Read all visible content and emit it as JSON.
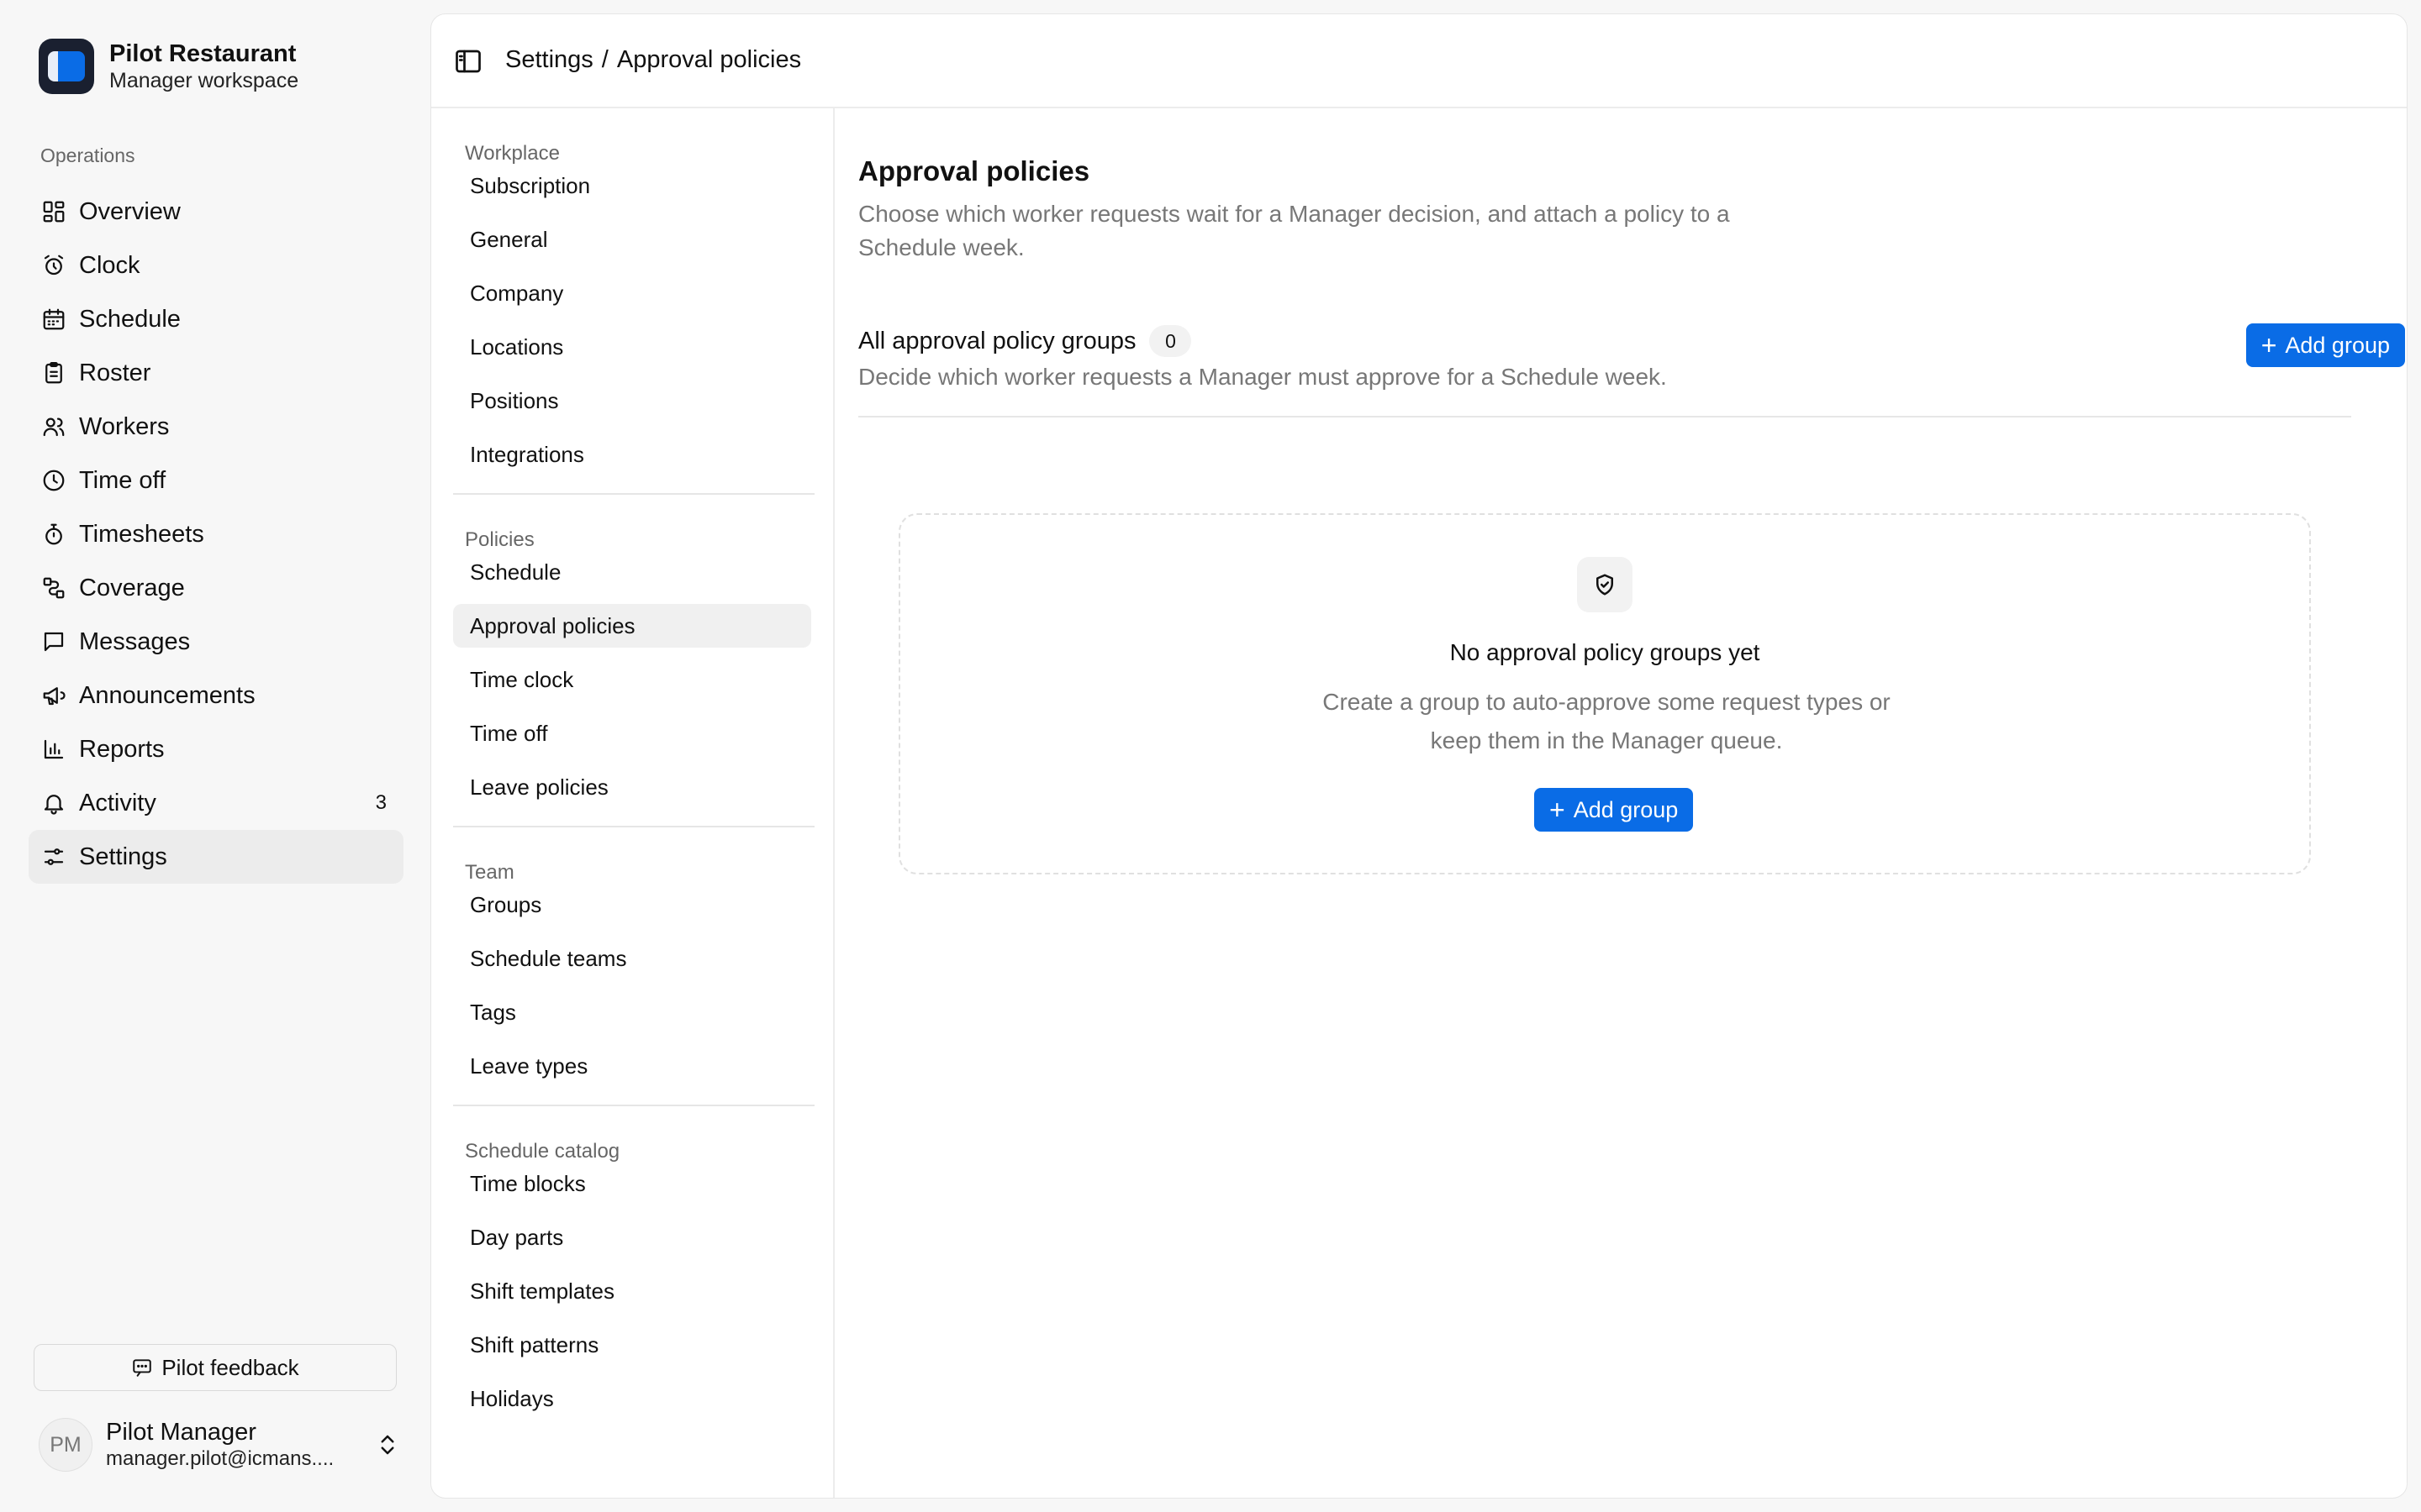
{
  "brand": {
    "name": "Pilot Restaurant",
    "subtitle": "Manager workspace"
  },
  "sidebar": {
    "section_label": "Operations",
    "items": [
      {
        "label": "Overview",
        "icon": "grid-icon"
      },
      {
        "label": "Clock",
        "icon": "alarm-clock-icon"
      },
      {
        "label": "Schedule",
        "icon": "calendar-icon"
      },
      {
        "label": "Roster",
        "icon": "clipboard-icon"
      },
      {
        "label": "Workers",
        "icon": "users-icon"
      },
      {
        "label": "Time off",
        "icon": "clock-icon"
      },
      {
        "label": "Timesheets",
        "icon": "stopwatch-icon"
      },
      {
        "label": "Coverage",
        "icon": "route-icon"
      },
      {
        "label": "Messages",
        "icon": "message-icon"
      },
      {
        "label": "Announcements",
        "icon": "megaphone-icon"
      },
      {
        "label": "Reports",
        "icon": "bar-chart-icon"
      },
      {
        "label": "Activity",
        "icon": "bell-icon",
        "badge": "3"
      },
      {
        "label": "Settings",
        "icon": "sliders-icon",
        "active": true
      }
    ],
    "feedback_label": "Pilot feedback",
    "user": {
      "initials": "PM",
      "name": "Pilot Manager",
      "email": "manager.pilot@icmans...."
    }
  },
  "topbar": {
    "crumb_root": "Settings",
    "crumb_sep": "/",
    "crumb_current": "Approval policies"
  },
  "subnav": {
    "groups": [
      {
        "label": "Workplace",
        "items": [
          "Subscription",
          "General",
          "Company",
          "Locations",
          "Positions",
          "Integrations"
        ]
      },
      {
        "label": "Policies",
        "items": [
          "Schedule",
          "Approval policies",
          "Time clock",
          "Time off",
          "Leave policies"
        ]
      },
      {
        "label": "Team",
        "items": [
          "Groups",
          "Schedule teams",
          "Tags",
          "Leave types"
        ]
      },
      {
        "label": "Schedule catalog",
        "items": [
          "Time blocks",
          "Day parts",
          "Shift templates",
          "Shift patterns",
          "Holidays"
        ]
      }
    ],
    "active_item": "Approval policies"
  },
  "content": {
    "title": "Approval policies",
    "description": "Choose which worker requests wait for a Manager decision, and attach a policy to a Schedule week.",
    "groups_title": "All approval policy groups",
    "groups_count": "0",
    "groups_description": "Decide which worker requests a Manager must approve for a Schedule week.",
    "add_group_label": "Add group",
    "empty": {
      "title": "No approval policy groups yet",
      "description": "Create a group to auto-approve some request types or keep them in the Manager queue.",
      "button_label": "Add group"
    }
  },
  "colors": {
    "accent": "#0a6ce6",
    "background": "#f7f7f7",
    "panel": "#ffffff",
    "muted_text": "#777777"
  }
}
